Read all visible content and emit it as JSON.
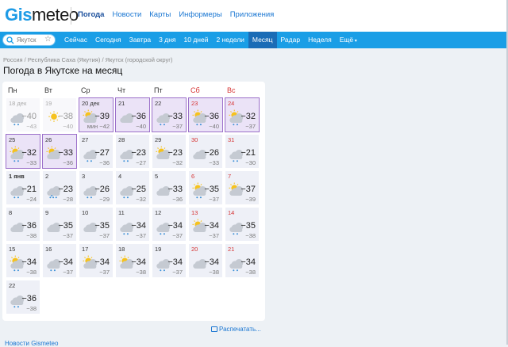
{
  "header": {
    "logo_part1": "Gis",
    "logo_part2": "meteo",
    "nav": [
      "Погода",
      "Новости",
      "Карты",
      "Информеры",
      "Приложения"
    ]
  },
  "search": {
    "placeholder": "Якутск"
  },
  "tabs": [
    "Сейчас",
    "Сегодня",
    "Завтра",
    "3 дня",
    "10 дней",
    "2 недели",
    "Месяц",
    "Радар",
    "Неделя",
    "Ещё"
  ],
  "active_tab": "Месяц",
  "breadcrumbs": "Россия / Республика Саха (Якутия) / Якутск (городской округ)",
  "title": "Погода в Якутске на месяц",
  "weekdays": [
    "Пн",
    "Вт",
    "Ср",
    "Чт",
    "Пт",
    "Сб",
    "Вс"
  ],
  "days": [
    {
      "date": "18 дек",
      "max": "−40",
      "min": "−43",
      "icon": "cloud-snow-icon",
      "state": "past"
    },
    {
      "date": "19",
      "max": "−38",
      "min": "−40",
      "icon": "sun-icon",
      "state": "past"
    },
    {
      "date": "20 дек",
      "max": "−39",
      "min": "мин −42",
      "icon": "sun-cloud-icon",
      "state": "month",
      "hl": true
    },
    {
      "date": "21",
      "max": "−36",
      "min": "−40",
      "icon": "cloud-icon",
      "state": "month",
      "hl": true
    },
    {
      "date": "22",
      "max": "−33",
      "min": "−37",
      "icon": "cloud-snow-icon",
      "state": "month",
      "hl": true
    },
    {
      "date": "23",
      "max": "−36",
      "min": "−40",
      "icon": "sun-cloud-snow-icon",
      "state": "month",
      "hl": true
    },
    {
      "date": "24",
      "max": "−32",
      "min": "−37",
      "icon": "sun-cloud-snow-icon",
      "state": "month",
      "hl": true
    },
    {
      "date": "25",
      "max": "−32",
      "min": "−33",
      "icon": "sun-cloud-snow-icon",
      "state": "month",
      "hl": true
    },
    {
      "date": "26",
      "max": "−33",
      "min": "−36",
      "icon": "sun-cloud-icon",
      "state": "month",
      "hl": true
    },
    {
      "date": "27",
      "max": "−27",
      "min": "−36",
      "icon": "cloud-snow-icon",
      "state": "normal"
    },
    {
      "date": "28",
      "max": "−23",
      "min": "−27",
      "icon": "cloud-snow-icon",
      "state": "normal"
    },
    {
      "date": "29",
      "max": "−23",
      "min": "−32",
      "icon": "sun-cloud-icon",
      "state": "normal"
    },
    {
      "date": "30",
      "max": "−26",
      "min": "−33",
      "icon": "cloud-icon",
      "state": "normal"
    },
    {
      "date": "31",
      "max": "−21",
      "min": "−30",
      "icon": "cloud-snow-icon",
      "state": "normal"
    },
    {
      "date": "1 янв",
      "max": "−21",
      "min": "−24",
      "icon": "cloud-snow-icon",
      "state": "normal",
      "bold": true
    },
    {
      "date": "2",
      "max": "−23",
      "min": "−28",
      "icon": "cloud-heavy-snow-icon",
      "state": "normal"
    },
    {
      "date": "3",
      "max": "−26",
      "min": "−29",
      "icon": "cloud-snow-icon",
      "state": "normal"
    },
    {
      "date": "4",
      "max": "−25",
      "min": "−32",
      "icon": "cloud-snow-icon",
      "state": "normal"
    },
    {
      "date": "5",
      "max": "−33",
      "min": "−36",
      "icon": "cloud-icon",
      "state": "normal"
    },
    {
      "date": "6",
      "max": "−35",
      "min": "−37",
      "icon": "sun-cloud-snow-icon",
      "state": "normal"
    },
    {
      "date": "7",
      "max": "−37",
      "min": "−39",
      "icon": "sun-cloud-icon",
      "state": "normal"
    },
    {
      "date": "8",
      "max": "−36",
      "min": "−38",
      "icon": "cloud-icon",
      "state": "normal"
    },
    {
      "date": "9",
      "max": "−35",
      "min": "−37",
      "icon": "cloud-icon",
      "state": "normal"
    },
    {
      "date": "10",
      "max": "−35",
      "min": "−37",
      "icon": "cloud-icon",
      "state": "normal"
    },
    {
      "date": "11",
      "max": "−34",
      "min": "−37",
      "icon": "cloud-snow-icon",
      "state": "normal"
    },
    {
      "date": "12",
      "max": "−34",
      "min": "−37",
      "icon": "cloud-snow-icon",
      "state": "normal"
    },
    {
      "date": "13",
      "max": "−34",
      "min": "−37",
      "icon": "sun-cloud-icon",
      "state": "normal"
    },
    {
      "date": "14",
      "max": "−35",
      "min": "−38",
      "icon": "cloud-snow-icon",
      "state": "normal"
    },
    {
      "date": "15",
      "max": "−34",
      "min": "−38",
      "icon": "sun-cloud-snow-icon",
      "state": "normal"
    },
    {
      "date": "16",
      "max": "−34",
      "min": "−37",
      "icon": "cloud-snow-icon",
      "state": "normal"
    },
    {
      "date": "17",
      "max": "−34",
      "min": "−37",
      "icon": "sun-cloud-icon",
      "state": "normal"
    },
    {
      "date": "18",
      "max": "−34",
      "min": "−38",
      "icon": "sun-cloud-icon",
      "state": "normal"
    },
    {
      "date": "19",
      "max": "−34",
      "min": "−37",
      "icon": "cloud-snow-icon",
      "state": "normal"
    },
    {
      "date": "20",
      "max": "−34",
      "min": "−38",
      "icon": "cloud-icon",
      "state": "normal"
    },
    {
      "date": "21",
      "max": "−34",
      "min": "−38",
      "icon": "cloud-snow-icon",
      "state": "normal"
    },
    {
      "date": "22",
      "max": "−36",
      "min": "−38",
      "icon": "cloud-snow-icon",
      "state": "normal"
    }
  ],
  "print_label": "Распечатать...",
  "footer_link": "Новости Gismeteo",
  "colors": {
    "accent": "#1a9ee6",
    "active_tab": "#1b6cb6",
    "weekend": "#d63333",
    "month_bg": "#ebe3f7",
    "highlight_border": "#9b6fc9"
  }
}
